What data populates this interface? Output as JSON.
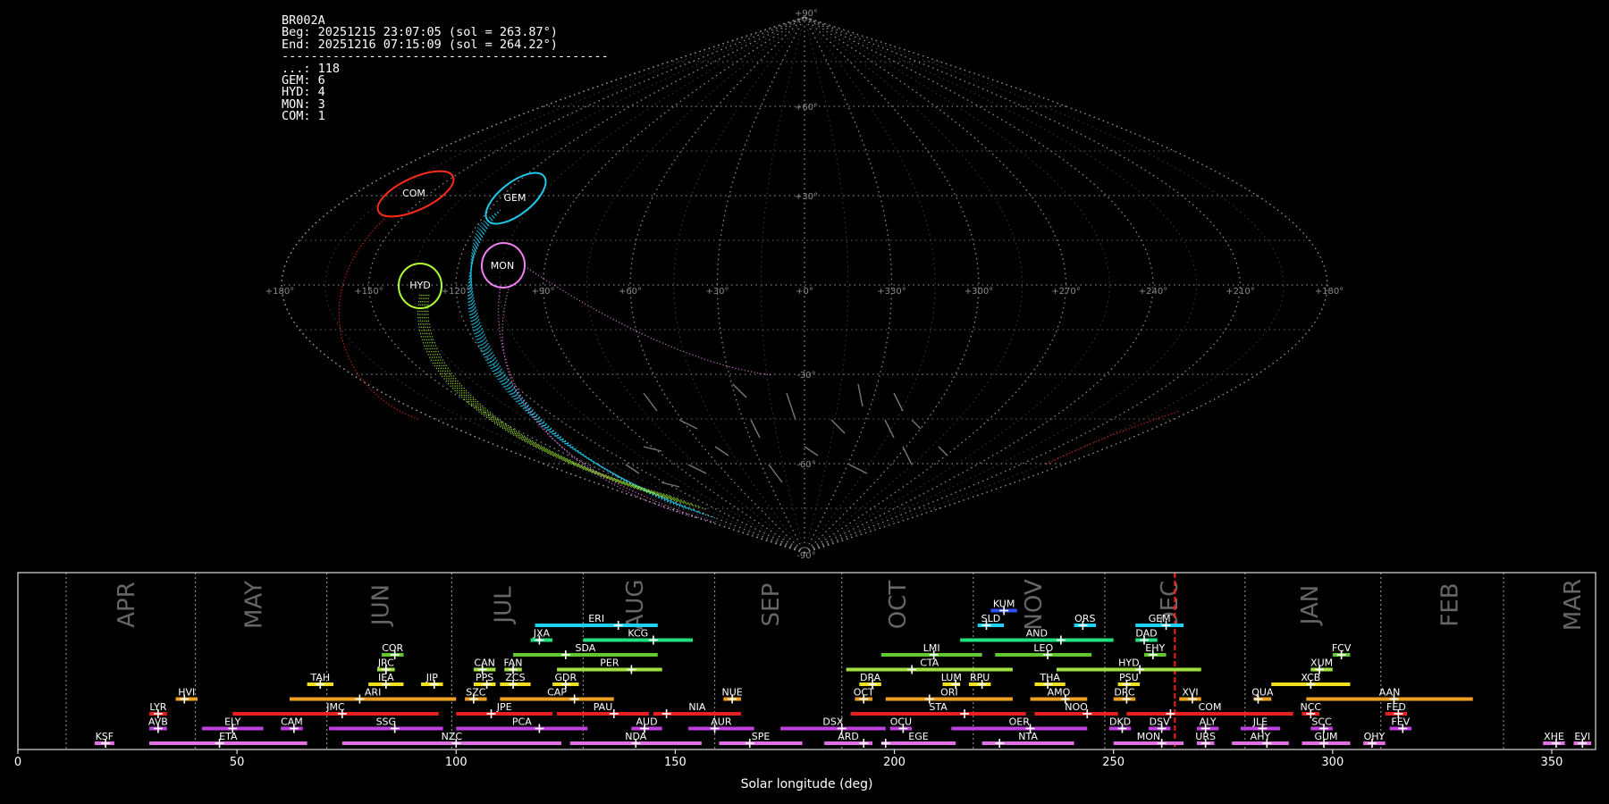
{
  "info_panel": {
    "station": "BR002A",
    "begin": "Beg: 20251215 23:07:05 (sol = 263.87°)",
    "end": "End: 20251216 07:15:09 (sol = 264.22°)",
    "separator": "---------------------------------------------",
    "counts": [
      {
        "code": "...",
        "count": 118
      },
      {
        "code": "GEM",
        "count": 6
      },
      {
        "code": "HYD",
        "count": 4
      },
      {
        "code": "MON",
        "count": 3
      },
      {
        "code": "COM",
        "count": 1
      }
    ]
  },
  "sky_map": {
    "projection": "sinusoidal",
    "lon_labels": [
      "+180°",
      "+150°",
      "+120°",
      "+90°",
      "+60°",
      "+30°",
      "+0°",
      "+330°",
      "+300°",
      "+270°",
      "+240°",
      "+210°",
      "+180°"
    ],
    "lat_labels": [
      "+90°",
      "+60°",
      "+30°",
      "-30°",
      "-60°",
      "-90°"
    ],
    "radiants": [
      {
        "code": "COM",
        "color": "#ff2a1a"
      },
      {
        "code": "GEM",
        "color": "#1ec8e8"
      },
      {
        "code": "HYD",
        "color": "#b0ff30"
      },
      {
        "code": "MON",
        "color": "#f080f0"
      }
    ]
  },
  "chart_data": {
    "type": "range",
    "xlabel": "Solar longitude (deg)",
    "xlim": [
      0,
      360
    ],
    "x_ticks": [
      0,
      50,
      100,
      150,
      200,
      250,
      300,
      350
    ],
    "current_solar_longitude": 264.0,
    "months": [
      {
        "label": "APR",
        "start": 11,
        "pos": 25
      },
      {
        "label": "MAY",
        "start": 40.5,
        "pos": 54
      },
      {
        "label": "JUN",
        "start": 70.5,
        "pos": 83
      },
      {
        "label": "JUL",
        "start": 99,
        "pos": 111
      },
      {
        "label": "AUG",
        "start": 129,
        "pos": 141
      },
      {
        "label": "SEP",
        "start": 159,
        "pos": 172
      },
      {
        "label": "OCT",
        "start": 188,
        "pos": 201
      },
      {
        "label": "NOV",
        "start": 218,
        "pos": 232
      },
      {
        "label": "DEC",
        "start": 248,
        "pos": 263
      },
      {
        "label": "JAN",
        "start": 280,
        "pos": 295
      },
      {
        "label": "FEB",
        "start": 311,
        "pos": 327
      },
      {
        "label": "MAR",
        "start": 339,
        "pos": 355
      }
    ],
    "showers": [
      {
        "code": "KSF",
        "start": 17.5,
        "end": 22,
        "peak": 20,
        "row": 0,
        "color": "#e070e0"
      },
      {
        "code": "ETA",
        "start": 30,
        "end": 66,
        "peak": 46,
        "row": 0,
        "color": "#e070e0"
      },
      {
        "code": "NZC",
        "start": 74,
        "end": 124,
        "peak": 100,
        "row": 0,
        "color": "#e070e0"
      },
      {
        "code": "NDA",
        "start": 126,
        "end": 156,
        "peak": 141,
        "row": 0,
        "color": "#e070e0"
      },
      {
        "code": "SPE",
        "start": 160,
        "end": 179,
        "peak": 167,
        "row": 0,
        "color": "#e070e0"
      },
      {
        "code": "ARD",
        "start": 184,
        "end": 195,
        "peak": 193,
        "row": 0,
        "color": "#e070e0"
      },
      {
        "code": "EGE",
        "start": 197,
        "end": 214,
        "peak": 198,
        "row": 0,
        "color": "#e070e0"
      },
      {
        "code": "NTA",
        "start": 220,
        "end": 241,
        "peak": 224,
        "row": 0,
        "color": "#e070e0"
      },
      {
        "code": "MON",
        "start": 250,
        "end": 266,
        "peak": 261,
        "row": 0,
        "color": "#e070e0"
      },
      {
        "code": "URS",
        "start": 269,
        "end": 273,
        "peak": 271,
        "row": 0,
        "color": "#e070e0"
      },
      {
        "code": "AHY",
        "start": 277,
        "end": 290,
        "peak": 285,
        "row": 0,
        "color": "#e070e0"
      },
      {
        "code": "GUM",
        "start": 293,
        "end": 304,
        "peak": 298,
        "row": 0,
        "color": "#e070e0"
      },
      {
        "code": "OHY",
        "start": 307,
        "end": 312,
        "peak": 309,
        "row": 0,
        "color": "#e070e0"
      },
      {
        "code": "XHE",
        "start": 348,
        "end": 353,
        "peak": 351,
        "row": 0,
        "color": "#e070e0"
      },
      {
        "code": "EVI",
        "start": 355,
        "end": 359,
        "peak": 357,
        "row": 0,
        "color": "#e070e0"
      },
      {
        "code": "AVB",
        "start": 30,
        "end": 34,
        "peak": 32,
        "row": 1,
        "color": "#c040e0"
      },
      {
        "code": "ELY",
        "start": 42,
        "end": 56,
        "peak": 49,
        "row": 1,
        "color": "#c040e0"
      },
      {
        "code": "CAM",
        "start": 60,
        "end": 65,
        "peak": 63,
        "row": 1,
        "color": "#c040e0"
      },
      {
        "code": "SSG",
        "start": 71,
        "end": 97,
        "peak": 86,
        "row": 1,
        "color": "#c040e0"
      },
      {
        "code": "PCA",
        "start": 100,
        "end": 130,
        "peak": 119,
        "row": 1,
        "color": "#c040e0"
      },
      {
        "code": "AUD",
        "start": 140,
        "end": 147,
        "peak": 143,
        "row": 1,
        "color": "#c040e0"
      },
      {
        "code": "AUR",
        "start": 153,
        "end": 168,
        "peak": 159,
        "row": 1,
        "color": "#c040e0"
      },
      {
        "code": "DSX",
        "start": 174,
        "end": 198,
        "peak": 188,
        "row": 1,
        "color": "#c040e0"
      },
      {
        "code": "OCU",
        "start": 199,
        "end": 204,
        "peak": 202,
        "row": 1,
        "color": "#c040e0"
      },
      {
        "code": "OER",
        "start": 213,
        "end": 244,
        "peak": 231,
        "row": 1,
        "color": "#c040e0"
      },
      {
        "code": "DKD",
        "start": 249,
        "end": 254,
        "peak": 252,
        "row": 1,
        "color": "#c040e0"
      },
      {
        "code": "DSV",
        "start": 258,
        "end": 263,
        "peak": 261,
        "row": 1,
        "color": "#c040e0"
      },
      {
        "code": "ALY",
        "start": 269,
        "end": 274,
        "peak": 271,
        "row": 1,
        "color": "#c040e0"
      },
      {
        "code": "JLE",
        "start": 279,
        "end": 288,
        "peak": 284,
        "row": 1,
        "color": "#c040e0"
      },
      {
        "code": "SCC",
        "start": 295,
        "end": 300,
        "peak": 298,
        "row": 1,
        "color": "#c040e0"
      },
      {
        "code": "FEV",
        "start": 313,
        "end": 318,
        "peak": 316,
        "row": 1,
        "color": "#c040e0"
      },
      {
        "code": "LYR",
        "start": 30,
        "end": 34,
        "peak": 32,
        "row": 2,
        "color": "#e82020"
      },
      {
        "code": "JMC",
        "start": 49,
        "end": 96,
        "peak": 74,
        "row": 2,
        "color": "#e82020"
      },
      {
        "code": "JPE",
        "start": 100,
        "end": 122,
        "peak": 108,
        "row": 2,
        "color": "#e82020"
      },
      {
        "code": "PAU",
        "start": 123,
        "end": 144,
        "peak": 136,
        "row": 2,
        "color": "#e82020"
      },
      {
        "code": "NIA",
        "start": 145,
        "end": 165,
        "peak": 148,
        "row": 2,
        "color": "#e82020"
      },
      {
        "code": "STA",
        "start": 190,
        "end": 230,
        "peak": 216,
        "row": 2,
        "color": "#e82020"
      },
      {
        "code": "NOO",
        "start": 232,
        "end": 251,
        "peak": 244,
        "row": 2,
        "color": "#e82020"
      },
      {
        "code": "COM",
        "start": 253,
        "end": 291,
        "peak": 263,
        "row": 2,
        "color": "#e82020"
      },
      {
        "code": "NCC",
        "start": 293,
        "end": 297,
        "peak": 295,
        "row": 2,
        "color": "#e82020"
      },
      {
        "code": "FED",
        "start": 312,
        "end": 317,
        "peak": 315,
        "row": 2,
        "color": "#e82020"
      },
      {
        "code": "HVI",
        "start": 36,
        "end": 41,
        "peak": 38,
        "row": 3,
        "color": "#f0a020"
      },
      {
        "code": "ARI",
        "start": 62,
        "end": 100,
        "peak": 78,
        "row": 3,
        "color": "#f0a020"
      },
      {
        "code": "SZC",
        "start": 102,
        "end": 107,
        "peak": 104,
        "row": 3,
        "color": "#f0a020"
      },
      {
        "code": "CAP",
        "start": 110,
        "end": 136,
        "peak": 127,
        "row": 3,
        "color": "#f0a020"
      },
      {
        "code": "NUE",
        "start": 161,
        "end": 165,
        "peak": 163,
        "row": 3,
        "color": "#f0a020"
      },
      {
        "code": "OCT",
        "start": 191,
        "end": 195,
        "peak": 193,
        "row": 3,
        "color": "#f0a020"
      },
      {
        "code": "ORI",
        "start": 198,
        "end": 227,
        "peak": 208,
        "row": 3,
        "color": "#f0a020"
      },
      {
        "code": "AMO",
        "start": 231,
        "end": 244,
        "peak": 239,
        "row": 3,
        "color": "#f0a020"
      },
      {
        "code": "DRC",
        "start": 250,
        "end": 255,
        "peak": 253,
        "row": 3,
        "color": "#f0a020"
      },
      {
        "code": "XVI",
        "start": 265,
        "end": 270,
        "peak": 268,
        "row": 3,
        "color": "#f0a020"
      },
      {
        "code": "QUA",
        "start": 282,
        "end": 286,
        "peak": 283,
        "row": 3,
        "color": "#f0a020"
      },
      {
        "code": "AAN",
        "start": 294,
        "end": 332,
        "peak": 314,
        "row": 3,
        "color": "#f0a020"
      },
      {
        "code": "TAH",
        "start": 66,
        "end": 72,
        "peak": 69,
        "row": 4,
        "color": "#f0e020"
      },
      {
        "code": "IEA",
        "start": 80,
        "end": 88,
        "peak": 84,
        "row": 4,
        "color": "#f0e020"
      },
      {
        "code": "JIP",
        "start": 92,
        "end": 97,
        "peak": 95,
        "row": 4,
        "color": "#f0e020"
      },
      {
        "code": "PPS",
        "start": 104,
        "end": 109,
        "peak": 107,
        "row": 4,
        "color": "#f0e020"
      },
      {
        "code": "ZCS",
        "start": 110,
        "end": 117,
        "peak": 113,
        "row": 4,
        "color": "#f0e020"
      },
      {
        "code": "GDR",
        "start": 122,
        "end": 128,
        "peak": 125,
        "row": 4,
        "color": "#f0e020"
      },
      {
        "code": "DRA",
        "start": 192,
        "end": 197,
        "peak": 195,
        "row": 4,
        "color": "#f0e020"
      },
      {
        "code": "LUM",
        "start": 211,
        "end": 215,
        "peak": 214,
        "row": 4,
        "color": "#f0e020"
      },
      {
        "code": "RPU",
        "start": 217,
        "end": 222,
        "peak": 220,
        "row": 4,
        "color": "#f0e020"
      },
      {
        "code": "THA",
        "start": 232,
        "end": 239,
        "peak": 235,
        "row": 4,
        "color": "#f0e020"
      },
      {
        "code": "PSU",
        "start": 251,
        "end": 256,
        "peak": 253,
        "row": 4,
        "color": "#f0e020"
      },
      {
        "code": "XCB",
        "start": 286,
        "end": 304,
        "peak": 295,
        "row": 4,
        "color": "#f0e020"
      },
      {
        "code": "JRC",
        "start": 82,
        "end": 86,
        "peak": 84,
        "row": 5,
        "color": "#a0e040"
      },
      {
        "code": "CAN",
        "start": 104,
        "end": 109,
        "peak": 106,
        "row": 5,
        "color": "#a0e040"
      },
      {
        "code": "FAN",
        "start": 111,
        "end": 115,
        "peak": 113,
        "row": 5,
        "color": "#a0e040"
      },
      {
        "code": "PER",
        "start": 123,
        "end": 147,
        "peak": 140,
        "row": 5,
        "color": "#a0e040"
      },
      {
        "code": "CTA",
        "start": 189,
        "end": 227,
        "peak": 204,
        "row": 5,
        "color": "#a0e040"
      },
      {
        "code": "HYD",
        "start": 237,
        "end": 270,
        "peak": 256,
        "row": 5,
        "color": "#a0e040"
      },
      {
        "code": "XUM",
        "start": 295,
        "end": 300,
        "peak": 297,
        "row": 5,
        "color": "#a0e040"
      },
      {
        "code": "COR",
        "start": 83,
        "end": 88,
        "peak": 86,
        "row": 6,
        "color": "#60c830"
      },
      {
        "code": "SDA",
        "start": 113,
        "end": 146,
        "peak": 125,
        "row": 6,
        "color": "#60c830"
      },
      {
        "code": "LMI",
        "start": 197,
        "end": 220,
        "peak": 209,
        "row": 6,
        "color": "#60c830"
      },
      {
        "code": "LEO",
        "start": 223,
        "end": 245,
        "peak": 235,
        "row": 6,
        "color": "#60c830"
      },
      {
        "code": "EHY",
        "start": 257,
        "end": 262,
        "peak": 259,
        "row": 6,
        "color": "#60c830"
      },
      {
        "code": "FCV",
        "start": 300,
        "end": 304,
        "peak": 302,
        "row": 6,
        "color": "#60c830"
      },
      {
        "code": "JXA",
        "start": 117,
        "end": 122,
        "peak": 119,
        "row": 7,
        "color": "#20e080"
      },
      {
        "code": "KCG",
        "start": 129,
        "end": 154,
        "peak": 145,
        "row": 7,
        "color": "#20e080"
      },
      {
        "code": "AND",
        "start": 215,
        "end": 250,
        "peak": 238,
        "row": 7,
        "color": "#20e080"
      },
      {
        "code": "DAD",
        "start": 255,
        "end": 260,
        "peak": 257,
        "row": 7,
        "color": "#20e080"
      },
      {
        "code": "ERI",
        "start": 118,
        "end": 146,
        "peak": 137,
        "row": 8,
        "color": "#20d0f0"
      },
      {
        "code": "SLD",
        "start": 219,
        "end": 225,
        "peak": 221,
        "row": 8,
        "color": "#20d0f0"
      },
      {
        "code": "ORS",
        "start": 241,
        "end": 246,
        "peak": 243,
        "row": 8,
        "color": "#20d0f0"
      },
      {
        "code": "GEM",
        "start": 255,
        "end": 266,
        "peak": 262,
        "row": 8,
        "color": "#20d0f0"
      },
      {
        "code": "KUM",
        "start": 222,
        "end": 228,
        "peak": 225,
        "row": 9,
        "color": "#3050f0"
      }
    ]
  }
}
